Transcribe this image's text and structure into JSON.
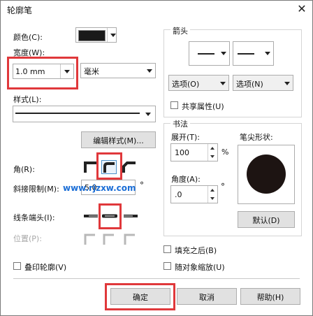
{
  "dialog": {
    "title": "轮廓笔",
    "close_glyph": "✕"
  },
  "left": {
    "color_label": "颜色(C):",
    "color_value": "#1a1a1a",
    "width_label": "宽度(W):",
    "width_value": "1.0 mm",
    "unit_value": "毫米",
    "style_label": "样式(L):",
    "edit_style_button": "编辑样式(M)...",
    "corner_label": "角(R):",
    "miter_label": "斜接限制(M):",
    "miter_value": "5.0",
    "degree": "°",
    "line_cap_label": "线条端头(I):",
    "position_label": "位置(P):",
    "overprint_label": "叠印轮廓(V)"
  },
  "watermark": "www.rjzxw.com",
  "arrows": {
    "group_label": "箭头",
    "options_left": "选项(O)",
    "options_right": "选项(N)",
    "share_label": "共享属性(U)"
  },
  "calligraphy": {
    "group_label": "书法",
    "stretch_label": "展开(T):",
    "stretch_value": "100",
    "percent": "%",
    "angle_label": "角度(A):",
    "angle_value": ".0",
    "degree": "°",
    "nib_label": "笔尖形状:",
    "default_button": "默认(D)"
  },
  "options": {
    "fill_behind_label": "填充之后(B)",
    "scale_with_image_label": "随对象缩放(U)"
  },
  "footer": {
    "ok": "确定",
    "cancel": "取消",
    "help": "帮助(H)"
  }
}
